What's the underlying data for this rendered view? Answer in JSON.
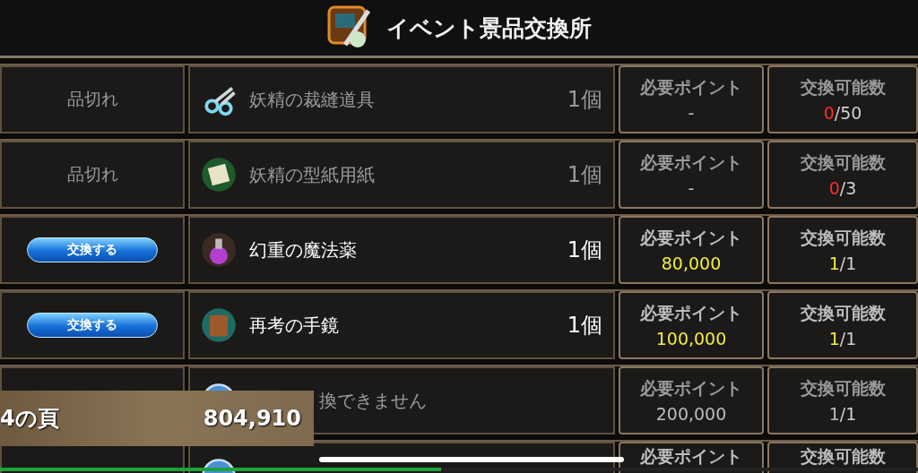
{
  "header": {
    "title": "イベント景品交換所"
  },
  "rows": [
    {
      "kind": "sold_out",
      "status": "品切れ",
      "name": "妖精の裁縫道具",
      "quantity": "1個",
      "points_label": "必要ポイント",
      "points": "-",
      "count_label": "交換可能数",
      "count_current": "0",
      "count_total": "/50"
    },
    {
      "kind": "sold_out",
      "status": "品切れ",
      "name": "妖精の型紙用紙",
      "quantity": "1個",
      "points_label": "必要ポイント",
      "points": "-",
      "count_label": "交換可能数",
      "count_current": "0",
      "count_total": "/3"
    },
    {
      "kind": "available",
      "button": "交換する",
      "name": "幻重の魔法薬",
      "quantity": "1個",
      "points_label": "必要ポイント",
      "points": "80,000",
      "count_label": "交換可能数",
      "count_current": "1",
      "count_total": "/1"
    },
    {
      "kind": "available",
      "button": "交換する",
      "name": "再考の手鏡",
      "quantity": "1個",
      "points_label": "必要ポイント",
      "points": "100,000",
      "count_label": "交換可能数",
      "count_current": "1",
      "count_total": "/1"
    },
    {
      "kind": "locked",
      "name": "換できません",
      "points_label": "必要ポイント",
      "points": "200,000",
      "count_label": "交換可能数",
      "count_current": "1",
      "count_total": "/1"
    },
    {
      "kind": "partial",
      "points_label": "必要ポイント",
      "count_label": "交換可能数"
    }
  ],
  "balance": {
    "label": "4の頁",
    "value": "804,910"
  },
  "progress": {
    "level": 0.48
  }
}
